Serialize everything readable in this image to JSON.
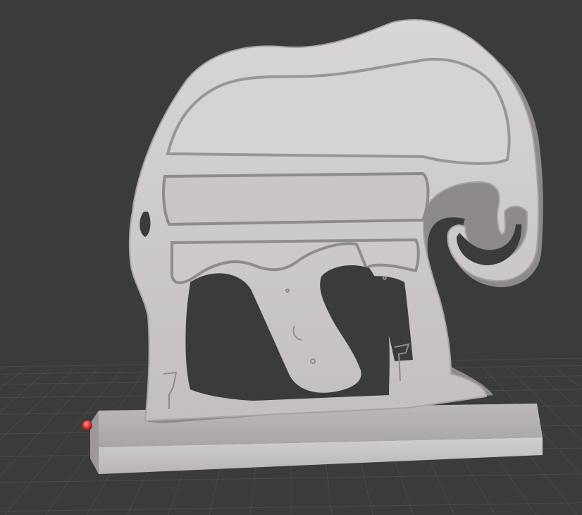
{
  "viewport": {
    "background_color": "#3b3b3b",
    "grid_color": "#4a4a4a",
    "grid_visible": true
  },
  "model": {
    "shape": "elephant-silhouette-relief-on-base-plate",
    "material_color": "#cfcccc",
    "shadow_color": "#8f8b8b",
    "hole_color": "#3b3b3b"
  },
  "origin_marker": {
    "icon": "origin-point-icon",
    "color": "#e0363a"
  }
}
